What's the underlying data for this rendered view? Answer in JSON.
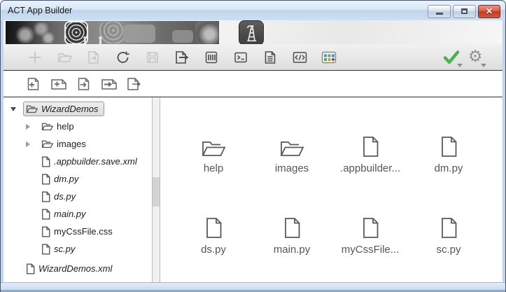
{
  "window": {
    "title": "ACT App Builder"
  },
  "colors": {
    "check_green": "#4db052",
    "close_red": "#c03a27",
    "frame_blue": "#c3d5ec",
    "palette_squares": [
      "#4a90d9",
      "#5aad5a",
      "#e8913a"
    ]
  },
  "banner": {
    "icon_names": [
      "spiral-app-icon",
      "signal-waves-icon",
      "rose-app-icon",
      "oil-derrick-app-icon"
    ]
  },
  "toolbars": {
    "main": {
      "buttons": [
        {
          "name": "add",
          "icon": "plus",
          "enabled": false
        },
        {
          "name": "open-project",
          "icon": "folder-open",
          "enabled": false
        },
        {
          "name": "open-file",
          "icon": "doc-arrow-in",
          "enabled": false
        },
        {
          "name": "refresh",
          "icon": "refresh",
          "enabled": true
        },
        {
          "name": "save",
          "icon": "save",
          "enabled": false
        },
        {
          "name": "export",
          "icon": "doc-arrow-out",
          "enabled": true
        },
        {
          "name": "barcode-view",
          "icon": "barcode",
          "enabled": true
        },
        {
          "name": "console",
          "icon": "terminal",
          "enabled": true
        },
        {
          "name": "log-document",
          "icon": "doc-lines",
          "enabled": true
        },
        {
          "name": "source-code",
          "icon": "code",
          "enabled": true
        },
        {
          "name": "widget-palette",
          "icon": "grid-plus",
          "enabled": true
        }
      ],
      "right_buttons": [
        {
          "name": "validate",
          "icon": "check",
          "enabled": true,
          "has_dropdown": true
        },
        {
          "name": "settings",
          "icon": "gear",
          "enabled": true,
          "has_dropdown": true
        }
      ]
    },
    "file": {
      "buttons": [
        {
          "name": "add-file",
          "icon": "file-plus"
        },
        {
          "name": "add-folder",
          "icon": "filewide-plus"
        },
        {
          "name": "import-file",
          "icon": "file-arrow"
        },
        {
          "name": "import-folder",
          "icon": "filewide-arrow"
        },
        {
          "name": "export-file",
          "icon": "file-export"
        }
      ]
    }
  },
  "sidebar": {
    "tree": [
      {
        "label": "WizardDemos",
        "icon": "folder",
        "arrow": "expanded",
        "level": 0,
        "italic": true,
        "selected": true
      },
      {
        "label": "help",
        "icon": "folder",
        "arrow": "collapsed",
        "level": 1,
        "italic": false,
        "selected": false
      },
      {
        "label": "images",
        "icon": "folder",
        "arrow": "collapsed",
        "level": 1,
        "italic": false,
        "selected": false
      },
      {
        "label": ".appbuilder.save.xml",
        "icon": "file",
        "arrow": "none",
        "level": 1,
        "italic": true,
        "selected": false
      },
      {
        "label": "dm.py",
        "icon": "file",
        "arrow": "none",
        "level": 1,
        "italic": true,
        "selected": false
      },
      {
        "label": "ds.py",
        "icon": "file",
        "arrow": "none",
        "level": 1,
        "italic": true,
        "selected": false
      },
      {
        "label": "main.py",
        "icon": "file",
        "arrow": "none",
        "level": 1,
        "italic": true,
        "selected": false
      },
      {
        "label": "myCssFile.css",
        "icon": "file",
        "arrow": "none",
        "level": 1,
        "italic": false,
        "selected": false
      },
      {
        "label": "sc.py",
        "icon": "file",
        "arrow": "none",
        "level": 1,
        "italic": true,
        "selected": false
      },
      {
        "label": "WizardDemos.xml",
        "icon": "file",
        "arrow": "none",
        "level": 0,
        "italic": true,
        "selected": false
      }
    ]
  },
  "main": {
    "items": [
      {
        "label": "help",
        "icon": "folder"
      },
      {
        "label": "images",
        "icon": "folder"
      },
      {
        "label": ".appbuilder...",
        "icon": "file"
      },
      {
        "label": "dm.py",
        "icon": "file"
      },
      {
        "label": "ds.py",
        "icon": "file"
      },
      {
        "label": "main.py",
        "icon": "file"
      },
      {
        "label": "myCssFile...",
        "icon": "file"
      },
      {
        "label": "sc.py",
        "icon": "file"
      }
    ]
  }
}
